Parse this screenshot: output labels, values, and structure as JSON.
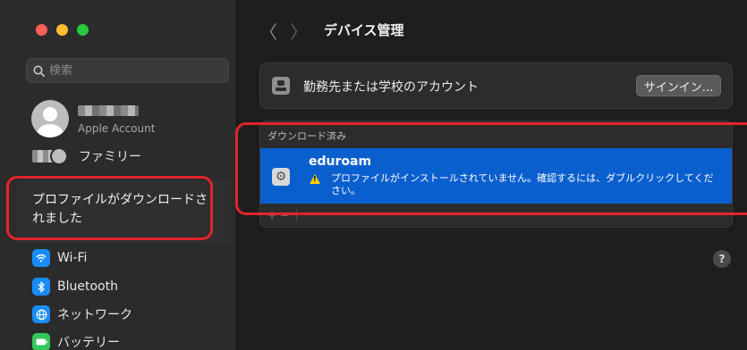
{
  "window": {
    "title": "デバイス管理"
  },
  "sidebar": {
    "search_placeholder": "検索",
    "account": {
      "subtitle": "Apple Account"
    },
    "family_label": "ファミリー",
    "notice": "プロファイルがダウンロードされました",
    "items": [
      {
        "label": "Wi-Fi",
        "icon": "wifi-icon"
      },
      {
        "label": "Bluetooth",
        "icon": "bluetooth-icon"
      },
      {
        "label": "ネットワーク",
        "icon": "globe-icon"
      },
      {
        "label": "バッテリー",
        "icon": "battery-icon"
      }
    ]
  },
  "main": {
    "work_account": {
      "label": "勤務先または学校のアカウント",
      "button": "サインイン..."
    },
    "downloaded": {
      "header": "ダウンロード済み",
      "profile": {
        "name": "eduroam",
        "message": "プロファイルがインストールされていません。確認するには、ダブルクリックしてください。"
      },
      "controls": "+ −"
    },
    "help": "?"
  },
  "colors": {
    "selection": "#0a5fcf",
    "highlight_box": "#e3242b",
    "warning": "#ffcc00"
  }
}
